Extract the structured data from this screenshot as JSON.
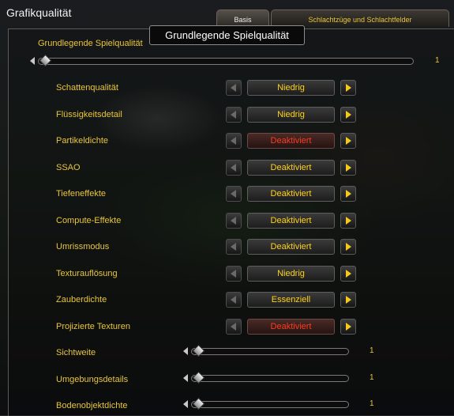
{
  "window": {
    "title": "Grafikqualität"
  },
  "tabs": [
    {
      "label": "Basis",
      "active": true
    },
    {
      "label": "Schlachtzüge und Schlachtfelder",
      "active": false
    }
  ],
  "tooltip": {
    "text": "Grundlegende Spielqualität"
  },
  "quality_slider": {
    "label": "Grundlegende Spielqualität",
    "value": "1"
  },
  "settings": [
    {
      "label": "Schattenqualität",
      "value": "Niedrig",
      "state": "normal"
    },
    {
      "label": "Flüssigkeitsdetail",
      "value": "Niedrig",
      "state": "normal"
    },
    {
      "label": "Partikeldichte",
      "value": "Deaktiviert",
      "state": "warning"
    },
    {
      "label": "SSAO",
      "value": "Deaktiviert",
      "state": "normal"
    },
    {
      "label": "Tiefeneffekte",
      "value": "Deaktiviert",
      "state": "normal"
    },
    {
      "label": "Compute-Effekte",
      "value": "Deaktiviert",
      "state": "normal"
    },
    {
      "label": "Umrissmodus",
      "value": "Deaktiviert",
      "state": "normal"
    },
    {
      "label": "Texturauflösung",
      "value": "Niedrig",
      "state": "normal"
    },
    {
      "label": "Zauberdichte",
      "value": "Essenziell",
      "state": "normal"
    },
    {
      "label": "Projizierte Texturen",
      "value": "Deaktiviert",
      "state": "warning"
    }
  ],
  "sliders": [
    {
      "label": "Sichtweite",
      "value": "1"
    },
    {
      "label": "Umgebungsdetails",
      "value": "1"
    },
    {
      "label": "Bodenobjektdichte",
      "value": "1"
    }
  ],
  "colors": {
    "label": "#e8c63c",
    "value": "#ffd21a",
    "warning": "#ff3b1f"
  }
}
